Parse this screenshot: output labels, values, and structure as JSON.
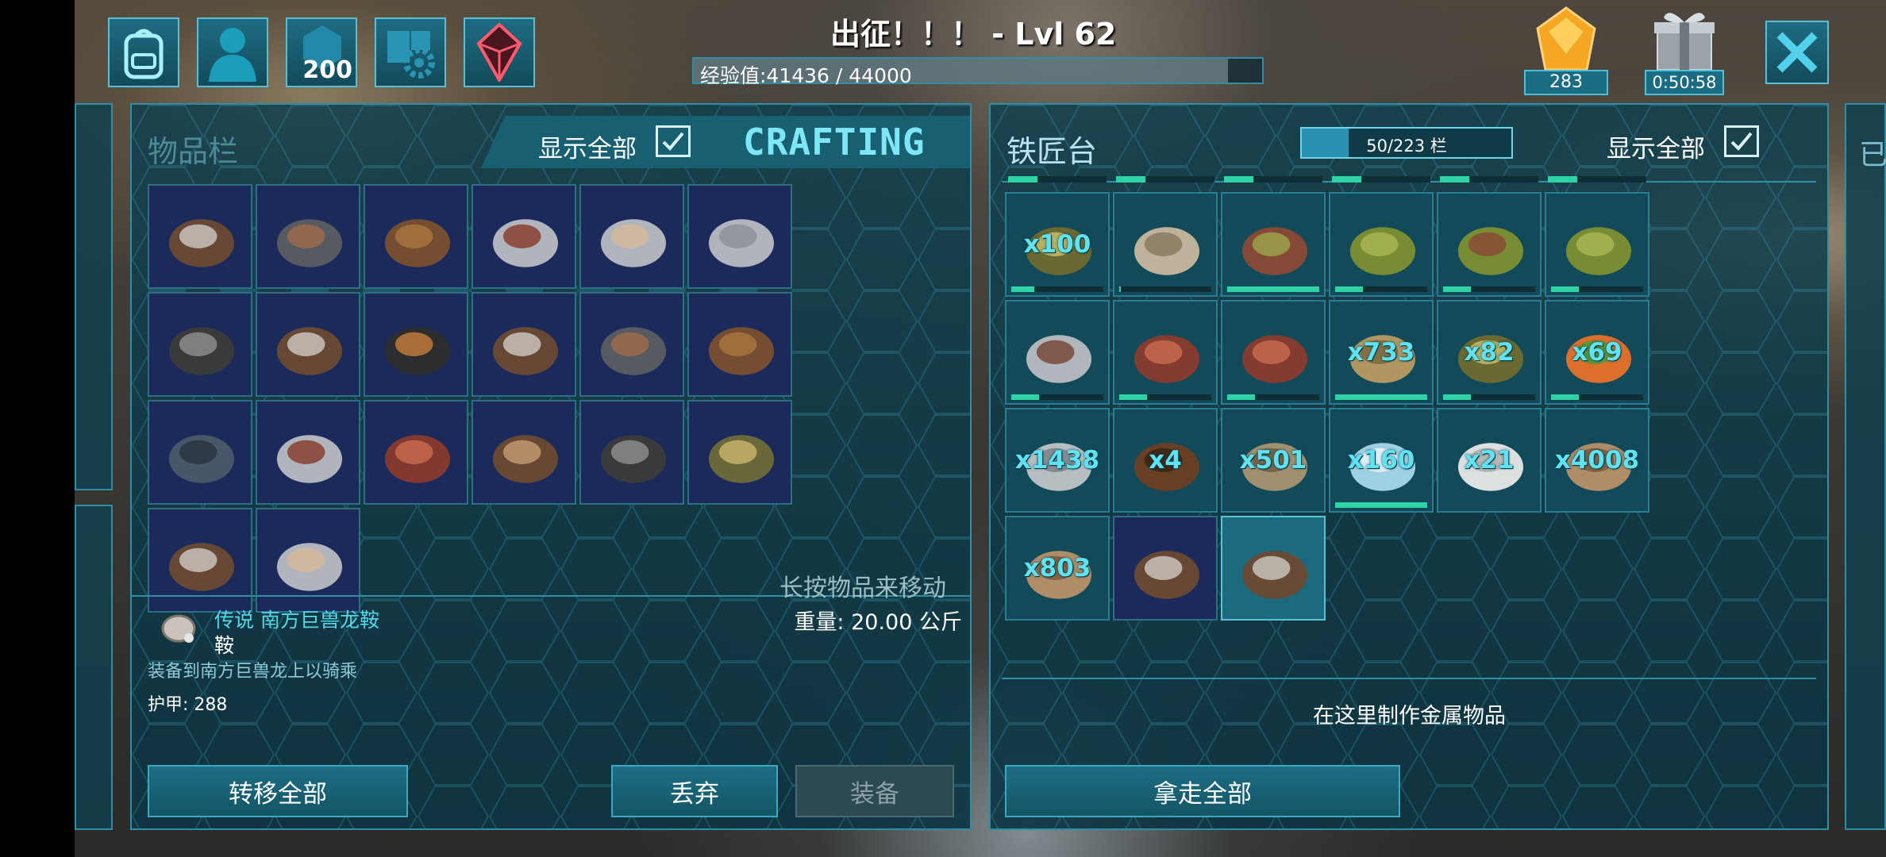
{
  "header": {
    "title": "出征！！！ - Lvl 62",
    "xp_text": "经验值:41436 / 44000",
    "xp_progress": 0.94,
    "gem_count": "283",
    "gift_timer": "0:50:58",
    "tribe_badge": "200"
  },
  "inventory": {
    "title": "物品栏",
    "show_all_label": "显示全部",
    "crafting_tab": "CRAFTING",
    "hint": "长按物品来移动",
    "weight": "重量: 20.00 公斤",
    "items": [
      {
        "icon": "saddle-icon"
      },
      {
        "icon": "pistol-icon"
      },
      {
        "icon": "crate-icon"
      },
      {
        "icon": "armor-boots-icon"
      },
      {
        "icon": "armor-gloves-icon"
      },
      {
        "icon": "armor-leggings-icon"
      },
      {
        "icon": "shotgun-icon"
      },
      {
        "icon": "saddle-icon"
      },
      {
        "icon": "flashlight-icon"
      },
      {
        "icon": "saddle-icon"
      },
      {
        "icon": "pistol-icon"
      },
      {
        "icon": "crate-icon"
      },
      {
        "icon": "map-icon"
      },
      {
        "icon": "armor-boots-icon"
      },
      {
        "icon": "armor-chest-icon"
      },
      {
        "icon": "harness-icon"
      },
      {
        "icon": "shotgun-icon"
      },
      {
        "icon": "ammo-icon"
      },
      {
        "icon": "saddle-icon"
      },
      {
        "icon": "armor-gloves-icon"
      }
    ],
    "selected_item": {
      "name": "传说 南方巨兽龙鞍",
      "type": "鞍",
      "description": "装备到南方巨兽龙上以骑乘",
      "armor": "护甲: 288"
    },
    "buttons": {
      "transfer_all": "转移全部",
      "drop": "丢弃",
      "equip": "装备"
    }
  },
  "smithy": {
    "title": "铁匠台",
    "capacity": "50/223 栏",
    "capacity_fraction": 0.224,
    "show_all_label": "显示全部",
    "info": "在这里制作金属物品",
    "take_all": "拿走全部",
    "items": [
      {
        "icon": "gunpowder-icon",
        "qty": "x100",
        "durability": 0.25
      },
      {
        "icon": "bandage-icon",
        "qty": "",
        "durability": 0.02
      },
      {
        "icon": "ghillie-boots-icon",
        "qty": "",
        "durability": 1.0
      },
      {
        "icon": "ghillie-chest-icon",
        "qty": "",
        "durability": 0.3
      },
      {
        "icon": "ghillie-gloves-icon",
        "qty": "",
        "durability": 0.3
      },
      {
        "icon": "ghillie-leggings-icon",
        "qty": "",
        "durability": 0.3
      },
      {
        "icon": "metal-chest-icon",
        "qty": "",
        "durability": 0.3
      },
      {
        "icon": "leather-leggings-icon",
        "qty": "",
        "durability": 0.3
      },
      {
        "icon": "leather-boots-icon",
        "qty": "",
        "durability": 0.3
      },
      {
        "icon": "fiber-bundle-icon",
        "qty": "x733",
        "durability": 1.0
      },
      {
        "icon": "gunpowder-icon",
        "qty": "x82",
        "durability": 0.3
      },
      {
        "icon": "carrot-icon",
        "qty": "x69",
        "durability": 0.3
      },
      {
        "icon": "metal-ingot-icon",
        "qty": "x1438",
        "durability": null
      },
      {
        "icon": "chitin-bowl-icon",
        "qty": "x4",
        "durability": null
      },
      {
        "icon": "thatch-icon",
        "qty": "x501",
        "durability": null
      },
      {
        "icon": "crystal-icon",
        "qty": "x160",
        "durability": 1.0
      },
      {
        "icon": "pearls-icon",
        "qty": "x21",
        "durability": null
      },
      {
        "icon": "hide-icon",
        "qty": "x4008",
        "durability": null
      },
      {
        "icon": "hide-icon",
        "qty": "x803",
        "durability": null
      },
      {
        "icon": "saddle-icon",
        "qty": "",
        "durability": null
      },
      {
        "icon": "saddle-icon",
        "qty": "",
        "durability": null
      }
    ]
  },
  "colors": {
    "accent": "#5fe3f3",
    "panel": "#10404e",
    "slot": "#1b2a5a",
    "durability": "#2fd3a8"
  }
}
